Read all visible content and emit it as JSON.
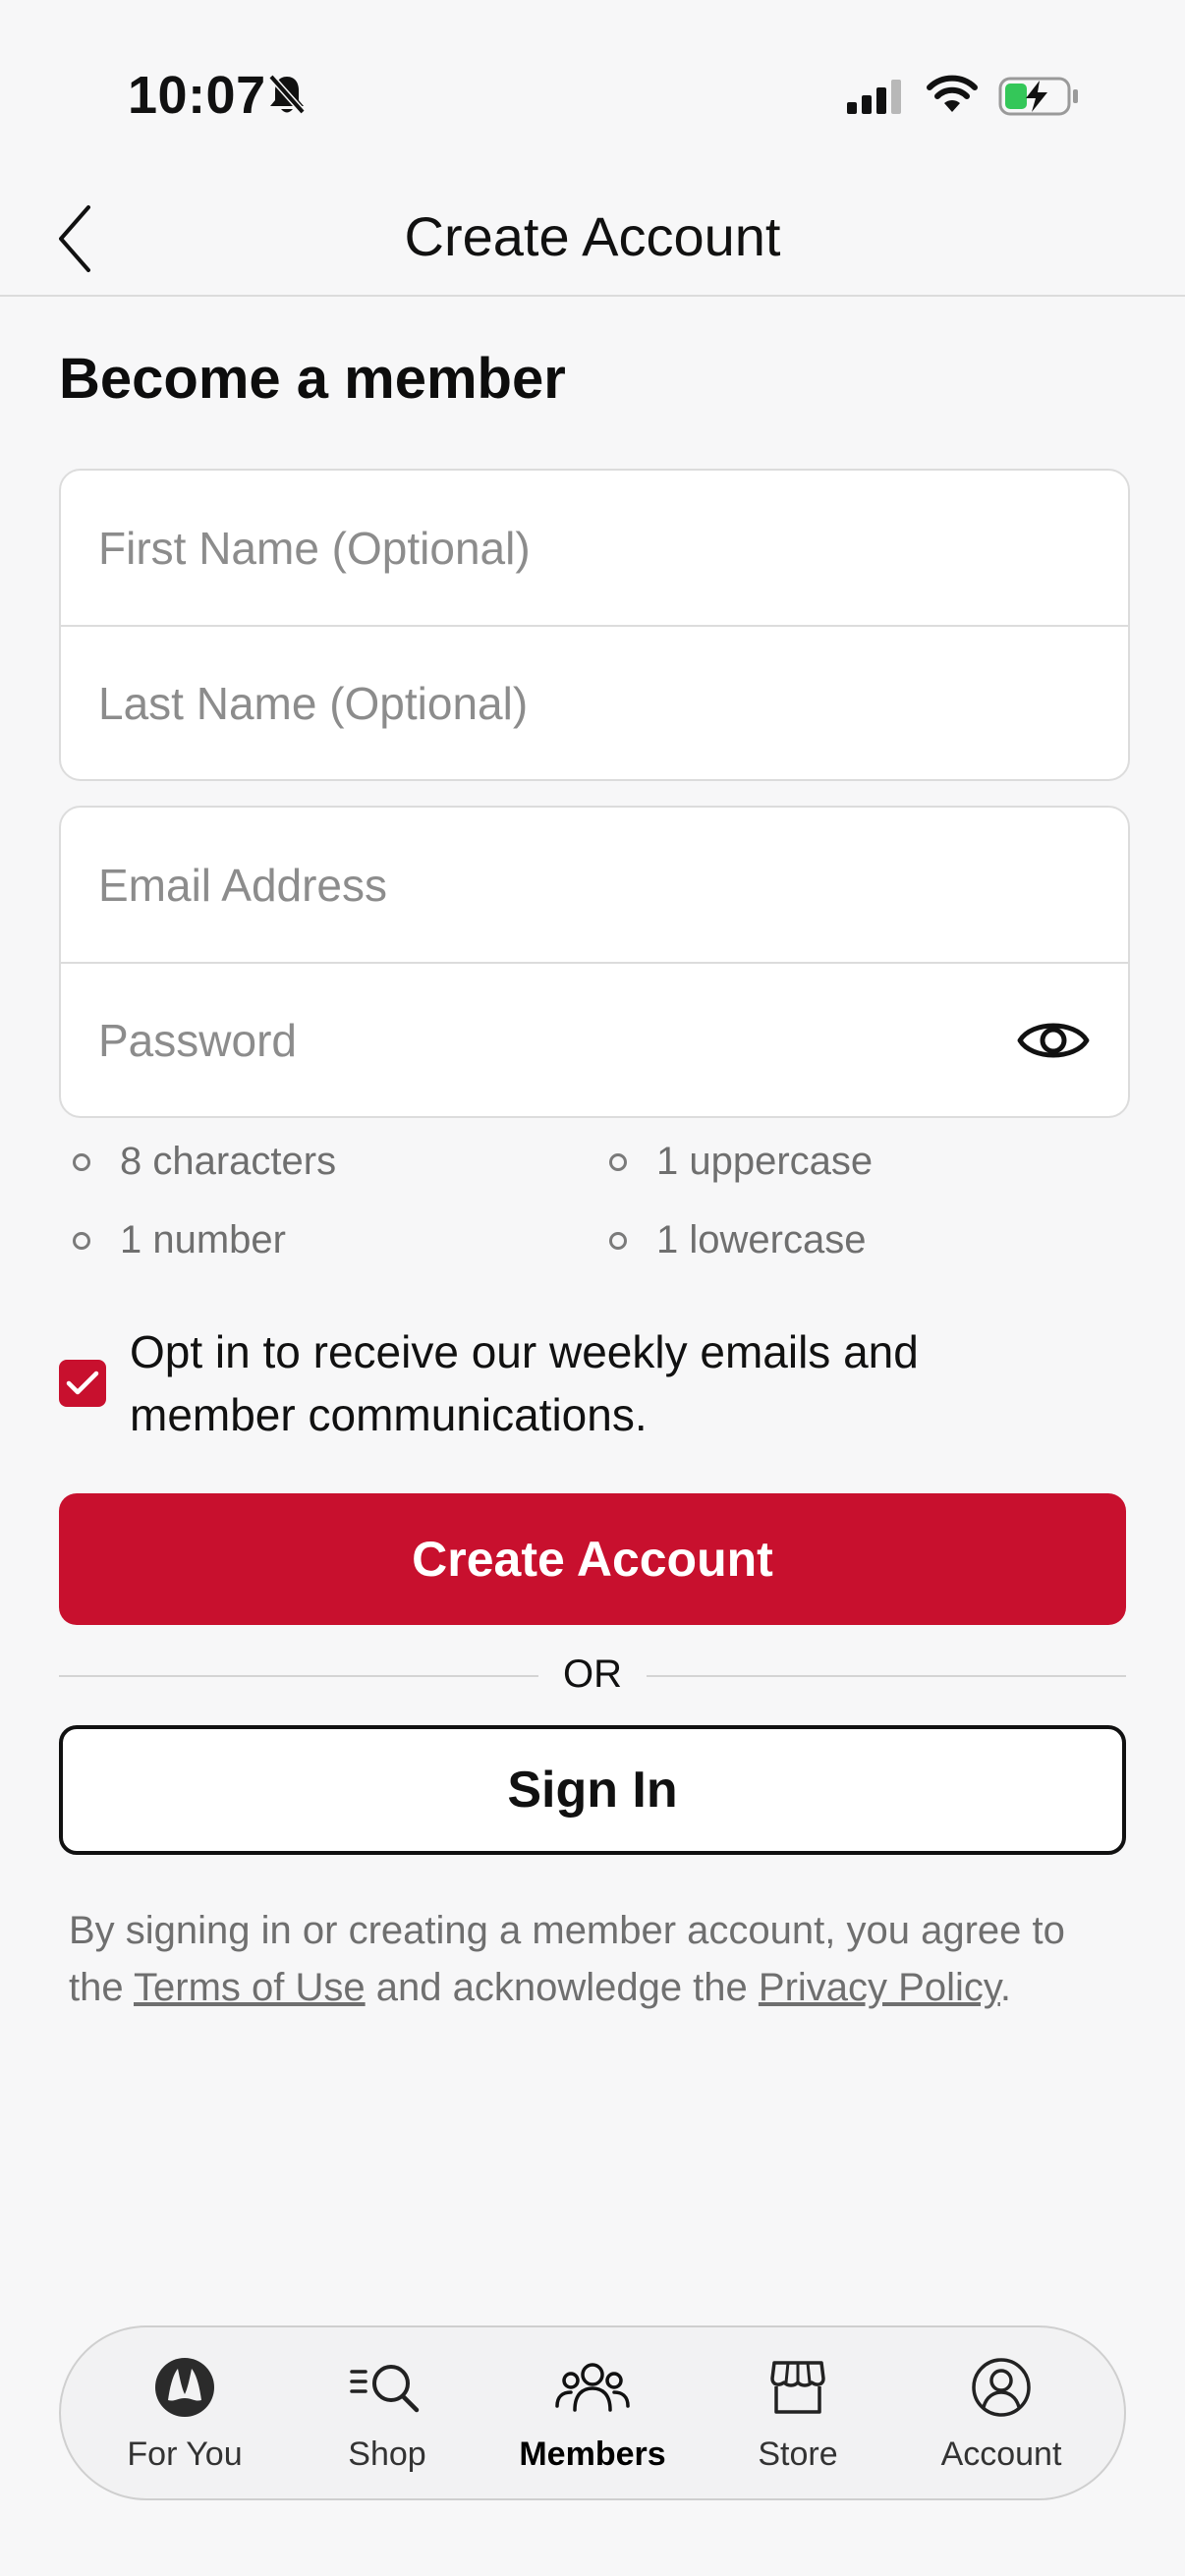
{
  "status_bar": {
    "time": "10:07"
  },
  "header": {
    "title": "Create Account"
  },
  "form": {
    "section_title": "Become a member",
    "first_name_placeholder": "First Name (Optional)",
    "last_name_placeholder": "Last Name (Optional)",
    "email_placeholder": "Email Address",
    "password_placeholder": "Password",
    "password_rules": [
      "8 characters",
      "1 uppercase",
      "1 number",
      "1 lowercase"
    ],
    "opt_in_text": "Opt in to receive our weekly emails and member communications.",
    "opt_in_checked": true
  },
  "actions": {
    "create_account_label": "Create Account",
    "or_label": "OR",
    "sign_in_label": "Sign In"
  },
  "legal": {
    "prefix": "By signing in or creating a member account, you agree to the ",
    "terms_link": "Terms of Use",
    "middle": " and acknowledge the ",
    "privacy_link": "Privacy Policy",
    "suffix": "."
  },
  "tab_bar": {
    "items": [
      {
        "label": "For You",
        "icon": "lululemon-logo-icon"
      },
      {
        "label": "Shop",
        "icon": "shop-search-icon"
      },
      {
        "label": "Members",
        "icon": "members-icon",
        "active": true
      },
      {
        "label": "Store",
        "icon": "store-icon"
      },
      {
        "label": "Account",
        "icon": "account-icon"
      }
    ]
  },
  "colors": {
    "accent": "#c8102e",
    "background": "#f7f7f8",
    "placeholder": "#8c8c8c",
    "battery_charge": "#34c759"
  }
}
